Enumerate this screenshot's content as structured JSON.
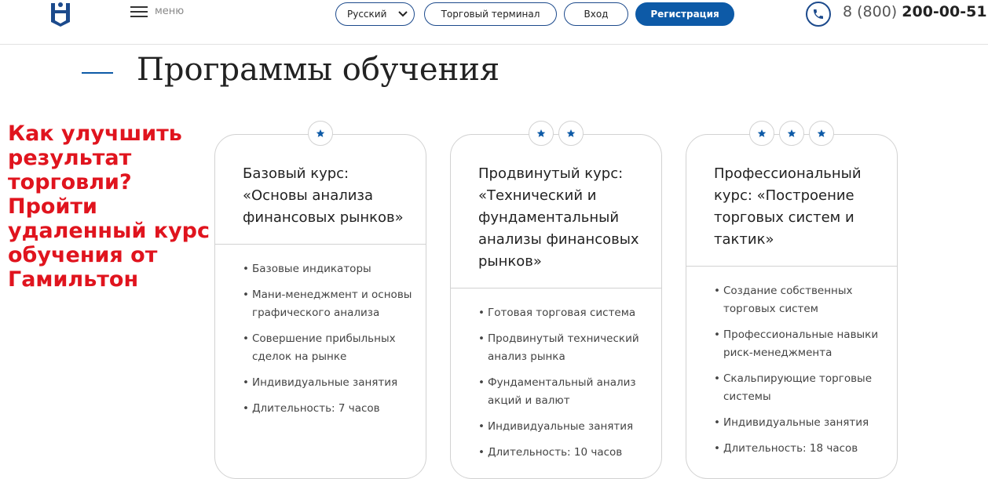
{
  "header": {
    "menu_label": "меню",
    "language": "Русский",
    "terminal_label": "Торговый терминал",
    "login_label": "Вход",
    "register_label": "Регистрация",
    "phone_prefix": "8 (800) ",
    "phone_main": "200-00-51"
  },
  "page_title": "Программы обучения",
  "promo_text": "Как улучшить результат торговли? Пройти удаленный курс обучения от Гамильтон",
  "colors": {
    "brand_blue": "#0d5aa7",
    "promo_red": "#e0141e",
    "border_gray": "#d2d2d2"
  },
  "cards": [
    {
      "stars": 1,
      "title": "Базовый курс: «Основы анализа финансовых рынков»",
      "features": [
        "Базовые индикаторы",
        "Мани-менеджмент и основы графического анализа",
        "Совершение прибыльных сделок на рынке",
        "Индивидуальные занятия",
        "Длительность: 7 часов"
      ]
    },
    {
      "stars": 2,
      "title": "Продвинутый курс: «Технический и фундаментальный анализы финансовых рынков»",
      "features": [
        "Готовая торговая система",
        "Продвинутый технический анализ рынка",
        "Фундаментальный анализ акций и валют",
        "Индивидуальные занятия",
        "Длительность: 10 часов"
      ]
    },
    {
      "stars": 3,
      "title": "Профессиональный курс: «Построение торговых систем и тактик»",
      "features": [
        "Создание собственных торговых систем",
        "Профессиональные навыки риск-менеджмента",
        "Скальпирующие торговые системы",
        "Индивидуальные занятия",
        "Длительность: 18 часов"
      ]
    }
  ]
}
